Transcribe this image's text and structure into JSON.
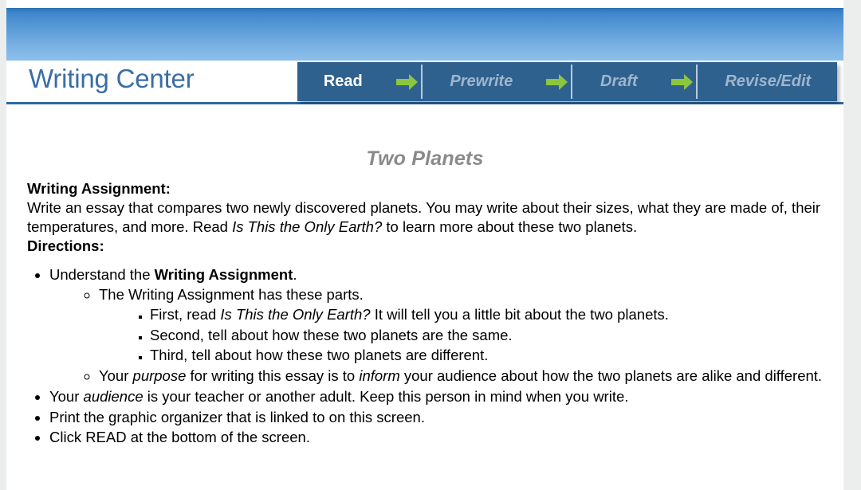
{
  "site": {
    "logo_text": "Writing Center"
  },
  "steps": {
    "items": [
      {
        "label": "Read",
        "state": "active"
      },
      {
        "label": "Prewrite",
        "state": "inactive"
      },
      {
        "label": "Draft",
        "state": "inactive"
      },
      {
        "label": "Revise/Edit",
        "state": "inactive"
      }
    ],
    "arrow_icon": "arrow-right-icon"
  },
  "colors": {
    "banner_top": "#2f79c0",
    "banner_bottom": "#8dbfea",
    "tabbar_bg": "#2f618f",
    "tab_active_text": "#ffffff",
    "tab_inactive_text": "#9fb6cc",
    "arrow_green": "#8cc63f",
    "logo_blue": "#3a6ea5",
    "rule_blue": "#2f6ba8",
    "title_gray": "#8a8a8a"
  },
  "document": {
    "title": "Two Planets",
    "assignment_label": "Writing Assignment:",
    "assignment_text_1": "Write an essay that compares two newly discovered planets. You may write about their sizes, what they are made of, their temperatures, and more. Read ",
    "assignment_reading_title": "Is This the Only Earth?",
    "assignment_text_2": " to learn more about these two planets.",
    "directions_label": "Directions:",
    "bullet_1_pre": "Understand the ",
    "bullet_1_bold": "Writing Assignment",
    "bullet_1_post": ".",
    "bullet_1_sub_1": "The Writing Assignment has these parts.",
    "sub_sub_1_pre": "First, read ",
    "sub_sub_1_italic": "Is This the Only Earth?",
    "sub_sub_1_post": " It will tell you a little bit about the two planets.",
    "sub_sub_2": "Second, tell about how these two planets are the same.",
    "sub_sub_3": "Third, tell about how these two planets are different.",
    "bullet_1_sub_2_a": "Your ",
    "bullet_1_sub_2_italic_1": "purpose",
    "bullet_1_sub_2_b": " for writing this essay is to ",
    "bullet_1_sub_2_italic_2": "inform",
    "bullet_1_sub_2_c": " your audience about how the two planets are alike and different.",
    "bullet_2_a": "Your ",
    "bullet_2_italic": "audience",
    "bullet_2_b": " is your teacher or another adult. Keep this person in mind when you write.",
    "bullet_3": "Print the graphic organizer that is linked to on this screen.",
    "bullet_4": "Click READ at the bottom of the screen."
  }
}
